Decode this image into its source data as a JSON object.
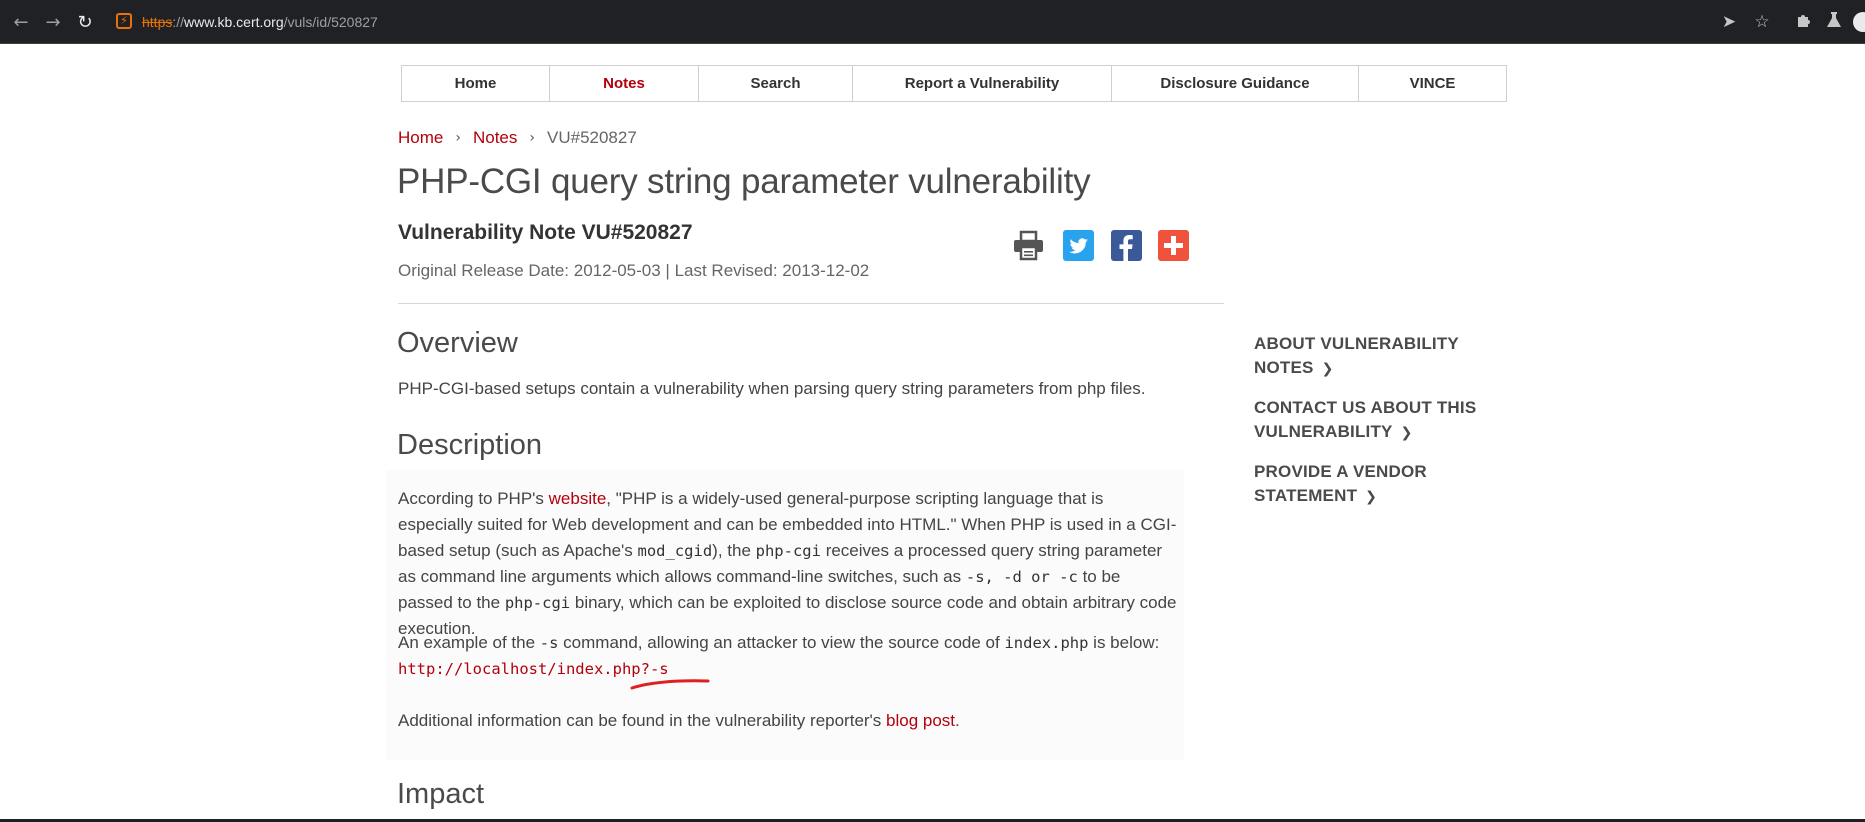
{
  "browser": {
    "url_protocol": "https",
    "url_sep": "://",
    "url_host": "www.kb.cert.org",
    "url_path": "/vuls/id/520827"
  },
  "nav": {
    "tabs": [
      {
        "label": "Home"
      },
      {
        "label": "Notes"
      },
      {
        "label": "Search"
      },
      {
        "label": "Report a Vulnerability"
      },
      {
        "label": "Disclosure Guidance"
      },
      {
        "label": "VINCE"
      }
    ]
  },
  "breadcrumb": {
    "home": "Home",
    "notes": "Notes",
    "current": "VU#520827"
  },
  "page": {
    "title": "PHP-CGI query string parameter vulnerability",
    "note_title": "Vulnerability Note VU#520827",
    "release": "Original Release Date: 2012-05-03 | Last Revised: 2013-12-02"
  },
  "overview": {
    "heading": "Overview",
    "text": "PHP-CGI-based setups contain a vulnerability when parsing query string parameters from php files."
  },
  "description": {
    "heading": "Description",
    "p1_a": "According to PHP's ",
    "p1_link": "website",
    "p1_b": ", \"PHP is a widely-used general-purpose scripting language that is especially suited for Web development and can be embedded into HTML.\" When PHP is used in a CGI-based setup (such as Apache's ",
    "p1_code1": "mod_cgid",
    "p1_c": "), the ",
    "p1_code2": "php-cgi",
    "p1_d": " receives a processed query string parameter as command line arguments which allows command-line switches, such as ",
    "p1_code3": "-s, -d or -c",
    "p1_e": " to be passed to the ",
    "p1_code4": "php-cgi",
    "p1_f": " binary, which can be exploited to disclose source code and obtain arbitrary code execution.",
    "p2_a": "An example of the ",
    "p2_code1": "-s",
    "p2_b": " command, allowing an attacker to view the source code of ",
    "p2_code2": "index.php",
    "p2_c": " is below:",
    "example_url": "http://localhost/index.php?-s",
    "p3_a": "Additional information can be found in the vulnerability reporter's ",
    "p3_link": "blog post",
    "p3_b": "."
  },
  "impact": {
    "heading": "Impact"
  },
  "sidebar": {
    "items": [
      {
        "line1": "ABOUT VULNERABILITY",
        "line2": "NOTES"
      },
      {
        "line1": "CONTACT US ABOUT THIS",
        "line2": "VULNERABILITY"
      },
      {
        "line1": "PROVIDE A VENDOR",
        "line2": "STATEMENT"
      }
    ]
  },
  "colors": {
    "accent": "#b3000c",
    "twitter": "#2aa3ef",
    "facebook": "#3b5998",
    "addthis": "#f0523c",
    "annotation": "#e02020"
  }
}
